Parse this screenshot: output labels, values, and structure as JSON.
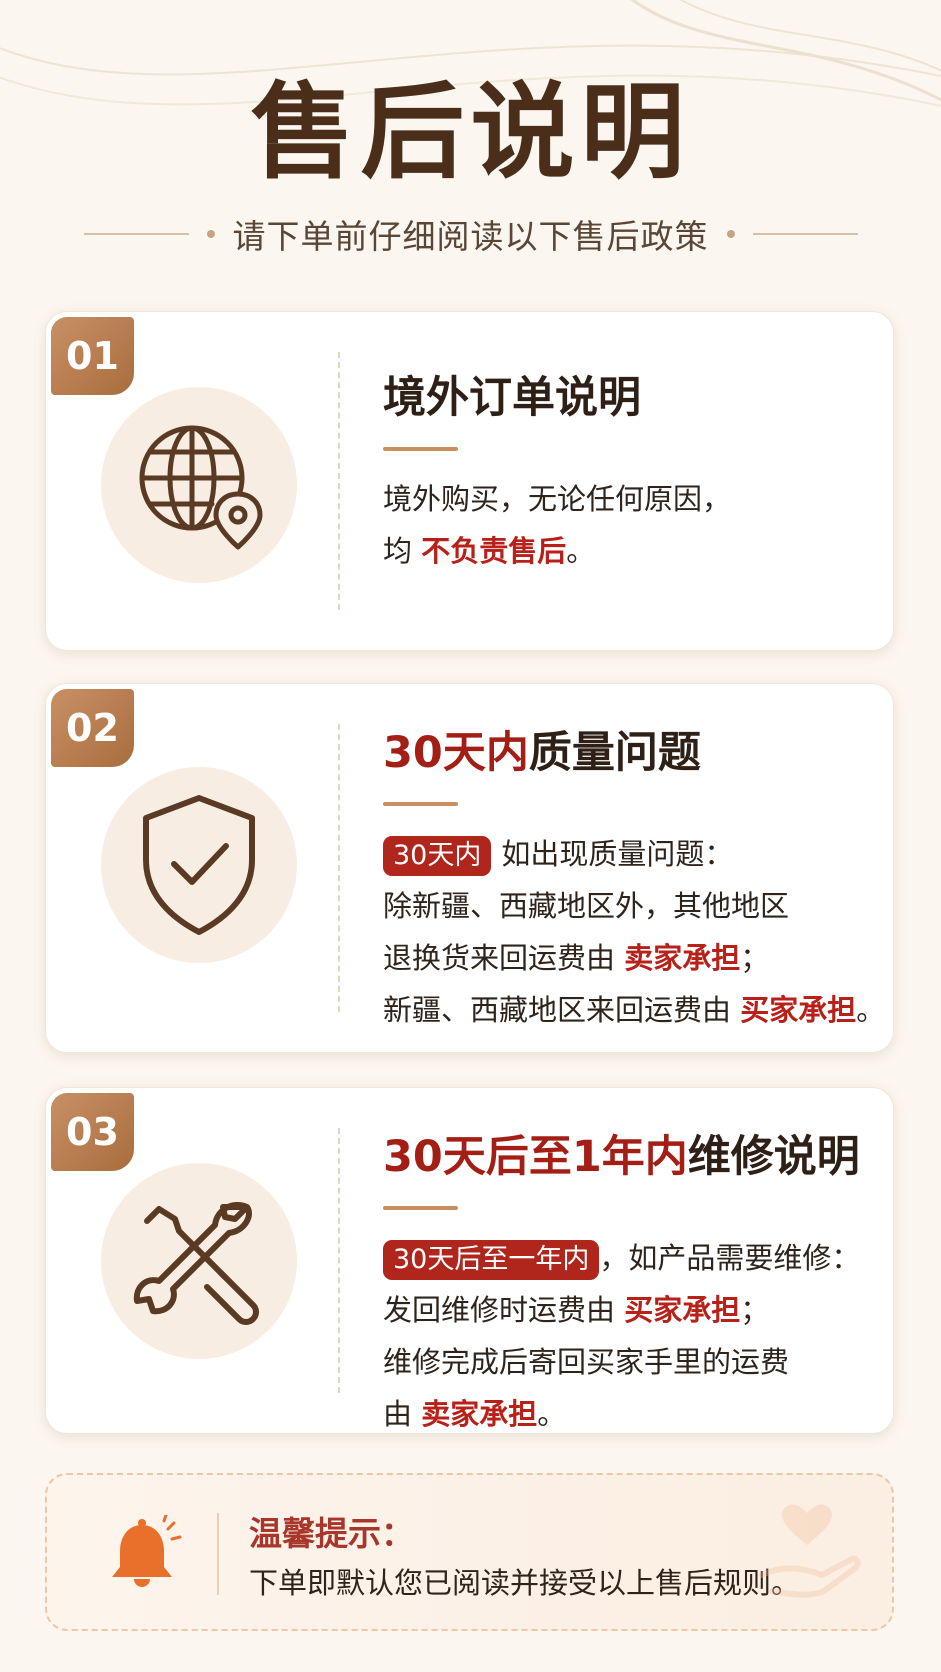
{
  "page": {
    "title": "售后说明",
    "subtitle": "请下单前仔细阅读以下售后政策"
  },
  "sections": [
    {
      "number": "01",
      "icon": "globe-location-icon",
      "title": "境外订单说明",
      "lines": [
        {
          "text": "境外购买，无论任何原因，"
        },
        {
          "prefix": "均 ",
          "highlight": "不负责售后",
          "suffix": "。"
        }
      ]
    },
    {
      "number": "02",
      "icon": "shield-check-icon",
      "title_highlight": "30天内",
      "title_rest": "质量问题",
      "pill": "30天内",
      "pill_text": "如出现质量问题：",
      "lines": [
        {
          "text": "除新疆、西藏地区外，其他地区"
        },
        {
          "prefix": "退换货来回运费由 ",
          "highlight": "卖家承担",
          "suffix": "；"
        },
        {
          "prefix": "新疆、西藏地区来回运费由 ",
          "highlight": "买家承担",
          "suffix": "。"
        }
      ]
    },
    {
      "number": "03",
      "icon": "wrench-screwdriver-icon",
      "title_highlight": "30天后至1年内",
      "title_rest": "维修说明",
      "pill": "30天后至一年内",
      "pill_text": "，如产品需要维修：",
      "lines": [
        {
          "prefix": "发回维修时运费由 ",
          "highlight": "买家承担",
          "suffix": "；"
        },
        {
          "text": "维修完成后寄回买家手里的运费"
        },
        {
          "prefix": "由 ",
          "highlight": "卖家承担",
          "suffix": "。"
        }
      ]
    }
  ],
  "tip": {
    "icon": "bell-icon",
    "title": "温馨提示：",
    "text": "下单即默认您已阅读并接受以上售后规则。",
    "decoration_icon": "heart-hand-icon"
  },
  "colors": {
    "brown": "#4a2e1a",
    "accent_red": "#a31f16",
    "badge_gold": "#b97a48",
    "bell_orange": "#e8702a"
  }
}
